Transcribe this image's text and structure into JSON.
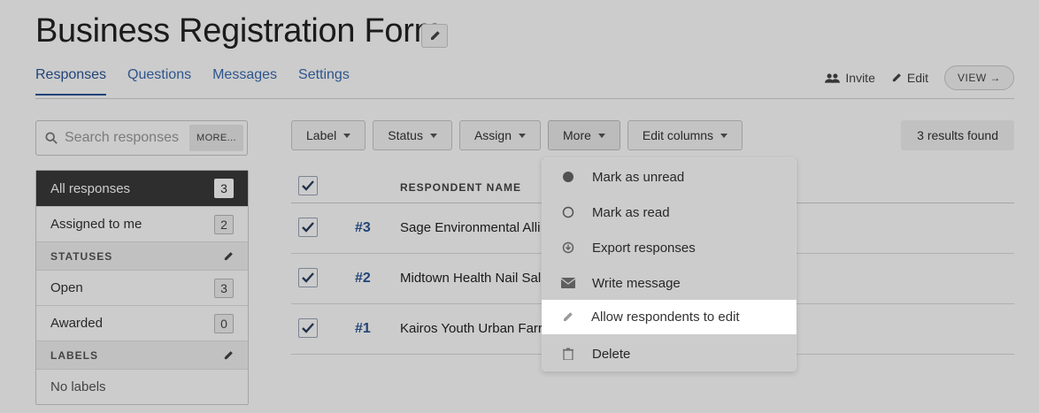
{
  "header": {
    "title": "Business Registration Form"
  },
  "tabs": [
    {
      "label": "Responses",
      "active": true
    },
    {
      "label": "Questions"
    },
    {
      "label": "Messages"
    },
    {
      "label": "Settings"
    }
  ],
  "top_actions": {
    "invite_label": "Invite",
    "edit_label": "Edit",
    "view_label": "VIEW →"
  },
  "search": {
    "placeholder": "Search responses",
    "more_label": "MORE..."
  },
  "sidebar": {
    "all_responses": {
      "label": "All responses",
      "count": "3"
    },
    "assigned": {
      "label": "Assigned to me",
      "count": "2"
    },
    "statuses_heading": "STATUSES",
    "statuses": [
      {
        "label": "Open",
        "count": "3"
      },
      {
        "label": "Awarded",
        "count": "0"
      }
    ],
    "labels_heading": "LABELS",
    "no_labels": "No labels"
  },
  "toolbar": {
    "label_btn": "Label",
    "status_btn": "Status",
    "assign_btn": "Assign",
    "more_btn": "More",
    "edit_columns_btn": "Edit columns",
    "results": "3 results found"
  },
  "table": {
    "column_name": "RESPONDENT NAME",
    "rows": [
      {
        "num": "#3",
        "name": "Sage Environmental Alli"
      },
      {
        "num": "#2",
        "name": "Midtown Health Nail Sal"
      },
      {
        "num": "#1",
        "name": "Kairos Youth Urban Farr"
      }
    ]
  },
  "more_menu": {
    "items": [
      {
        "label": "Mark as unread",
        "icon": "filled-circle-icon"
      },
      {
        "label": "Mark as read",
        "icon": "empty-circle-icon"
      },
      {
        "label": "Export responses",
        "icon": "download-circle-icon"
      },
      {
        "label": "Write message",
        "icon": "envelope-icon"
      },
      {
        "label": "Allow respondents to edit",
        "icon": "pencil-icon",
        "highlighted": true
      },
      {
        "label": "Delete",
        "icon": "trash-icon"
      }
    ]
  },
  "colors": {
    "link": "#2a5596",
    "active_sidebar": "#3a3a3a",
    "overlay": "rgba(0,0,0,0.2)"
  }
}
